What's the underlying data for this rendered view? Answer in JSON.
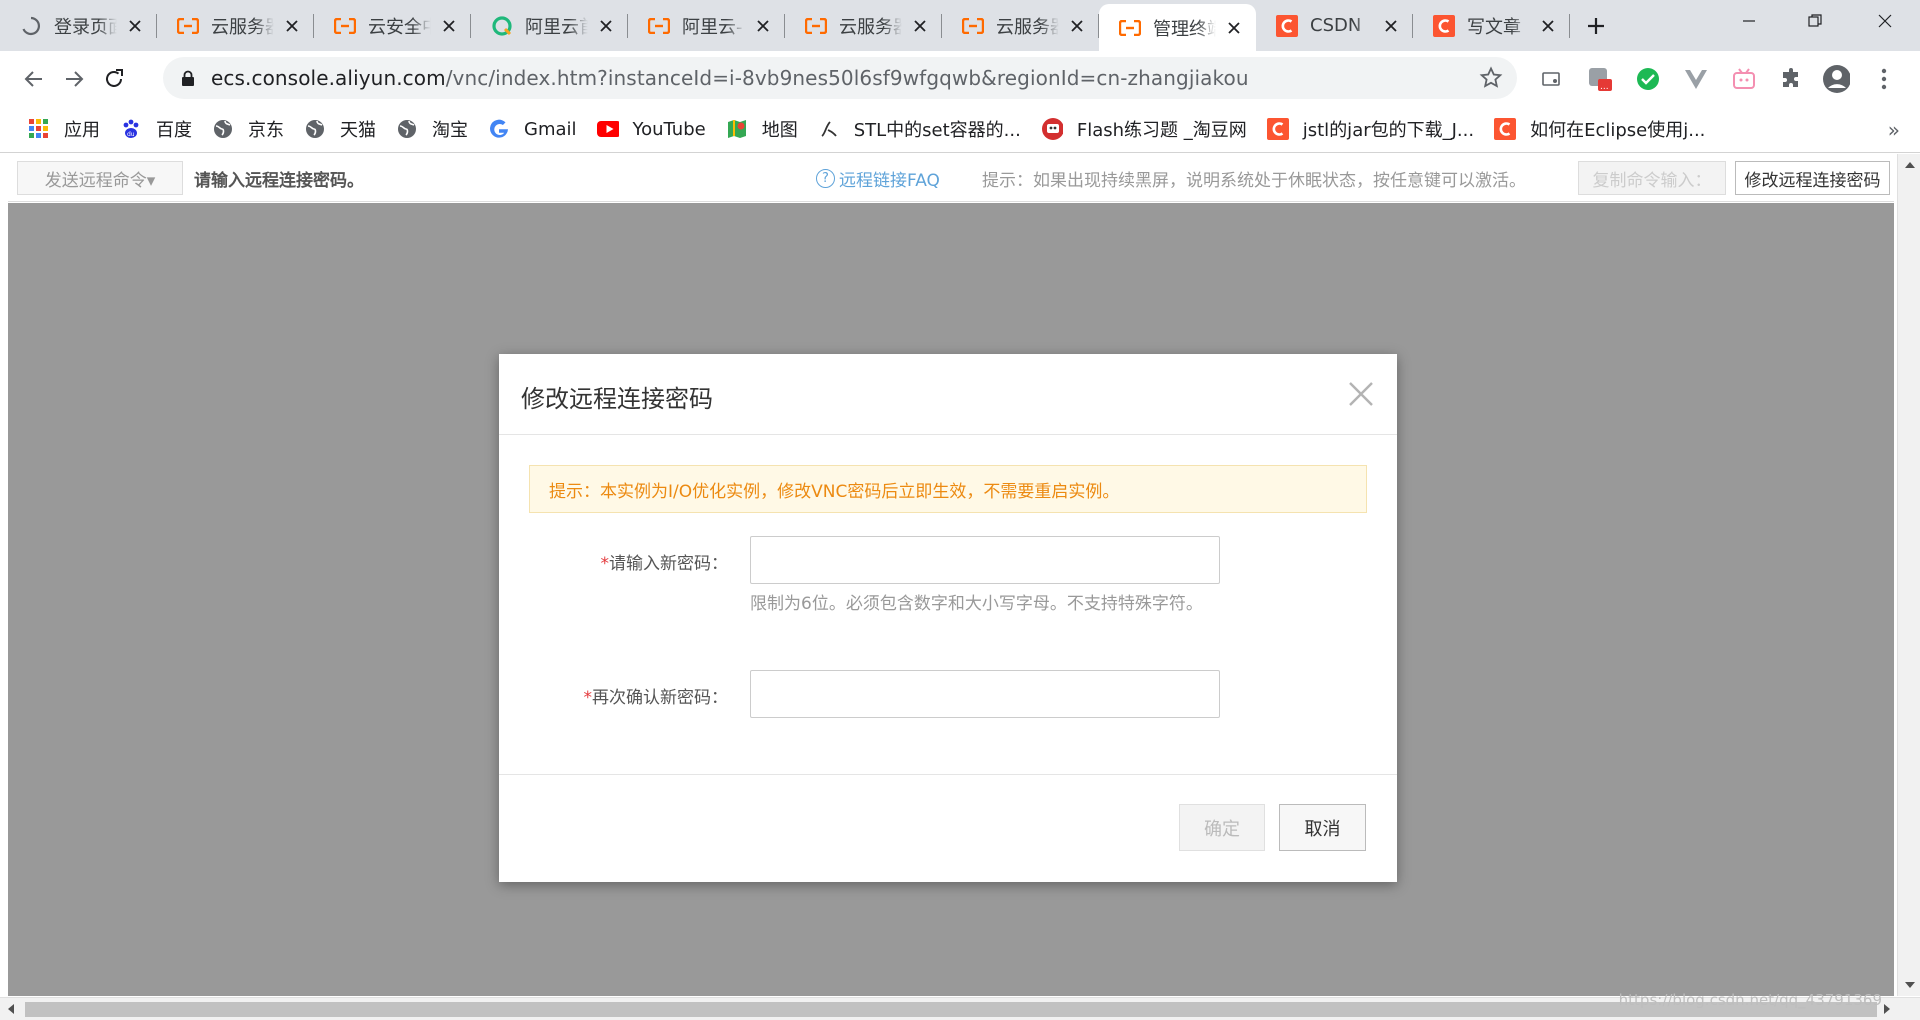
{
  "browser": {
    "tabs": [
      {
        "title": "登录页面",
        "icon": "loading-spinner-icon",
        "active": false
      },
      {
        "title": "云服务器",
        "icon": "aliyun-logo-icon",
        "active": false
      },
      {
        "title": "云安全中心",
        "icon": "aliyun-logo-icon",
        "active": false
      },
      {
        "title": "阿里云首页",
        "icon": "aliyun-green-q-icon",
        "active": false
      },
      {
        "title": "阿里云-",
        "icon": "aliyun-logo-icon",
        "active": false
      },
      {
        "title": "云服务器",
        "icon": "aliyun-logo-icon",
        "active": false
      },
      {
        "title": "云服务器",
        "icon": "aliyun-logo-icon",
        "active": false
      },
      {
        "title": "管理终端",
        "icon": "aliyun-logo-icon",
        "active": true
      },
      {
        "title": "CSDN",
        "icon": "csdn-logo-icon",
        "active": false
      },
      {
        "title": "写文章",
        "icon": "csdn-logo-icon",
        "active": false
      }
    ],
    "url_domain": "ecs.console.aliyun.com",
    "url_path": "/vnc/index.htm?instanceId=i-8vb9nes50l6sf9wfgqwb&regionId=cn-zhangjiakou",
    "bookmarks": [
      {
        "label": "应用",
        "icon": "apps-grid-icon"
      },
      {
        "label": "百度",
        "icon": "baidu-paw-icon"
      },
      {
        "label": "京东",
        "icon": "globe-icon"
      },
      {
        "label": "天猫",
        "icon": "globe-icon"
      },
      {
        "label": "淘宝",
        "icon": "globe-icon"
      },
      {
        "label": "Gmail",
        "icon": "google-g-icon"
      },
      {
        "label": "YouTube",
        "icon": "youtube-icon"
      },
      {
        "label": "地图",
        "icon": "maps-pin-icon"
      },
      {
        "label": "STL中的set容器的...",
        "icon": "cursor-script-icon"
      },
      {
        "label": "Flash练习题 _淘豆网",
        "icon": "red-face-icon"
      },
      {
        "label": "jstl的jar包的下载_J...",
        "icon": "csdn-logo-icon"
      },
      {
        "label": "如何在Eclipse使用j...",
        "icon": "csdn-logo-icon"
      }
    ],
    "more": "»"
  },
  "vnc": {
    "send_command": "发送远程命令▾",
    "status": "请输入远程连接密码。",
    "faq": "远程链接FAQ",
    "tip": "提示：如果出现持续黑屏，说明系统处于休眠状态，按任意键可以激活。",
    "copy_command": "复制命令输入：",
    "change_password": "修改远程连接密码"
  },
  "modal": {
    "title": "修改远程连接密码",
    "notice": "提示：本实例为I/O优化实例，修改VNC密码后立即生效，不需要重启实例。",
    "new_password_label": "请输入新密码：",
    "new_password_value": "",
    "help": "限制为6位。必须包含数字和大小写字母。不支持特殊字符。",
    "confirm_label": "再次确认新密码：",
    "confirm_value": "",
    "required_mark": "*",
    "ok": "确定",
    "cancel": "取消"
  },
  "watermark": "https://blog.csdn.net/qq_43791369",
  "colors": {
    "aliyun_orange": "#ff6a00",
    "csdn_red": "#fc5531",
    "notice_text": "#ec8a11",
    "faq_link": "#5fa3d9"
  }
}
